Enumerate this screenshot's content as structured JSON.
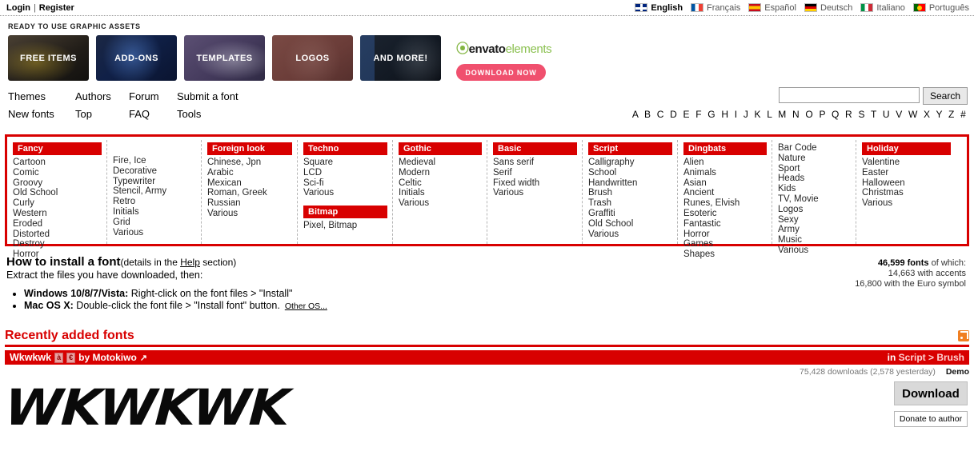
{
  "topbar": {
    "login": "Login",
    "separator": "|",
    "register": "Register",
    "languages": [
      {
        "name": "English",
        "flag": "uk",
        "active": true
      },
      {
        "name": "Français",
        "flag": "fr",
        "active": false
      },
      {
        "name": "Español",
        "flag": "es",
        "active": false
      },
      {
        "name": "Deutsch",
        "flag": "de",
        "active": false
      },
      {
        "name": "Italiano",
        "flag": "it",
        "active": false
      },
      {
        "name": "Português",
        "flag": "pt",
        "active": false
      }
    ]
  },
  "ad": {
    "title": "READY TO USE GRAPHIC ASSETS",
    "tiles": [
      {
        "label": "FREE ITEMS"
      },
      {
        "label": "ADD-ONS"
      },
      {
        "label": "TEMPLATES"
      },
      {
        "label": "LOGOS"
      },
      {
        "label": "AND MORE!"
      }
    ],
    "brand_leaf": "envato",
    "brand_rest": "elements",
    "cta": "DOWNLOAD NOW",
    "cta_color": "#f0506e"
  },
  "nav": {
    "items": [
      "Themes",
      "Authors",
      "Forum",
      "Submit a font",
      "New fonts",
      "Top",
      "FAQ",
      "Tools"
    ]
  },
  "search": {
    "value": "",
    "placeholder": "",
    "button": "Search",
    "alphabet": "A B C D E F G H I J K L M N O P Q R S T U V W X Y Z #"
  },
  "categories": [
    {
      "header": "Fancy",
      "items": [
        "Cartoon",
        "Comic",
        "Groovy",
        "Old School",
        "Curly",
        "Western",
        "Eroded",
        "Distorted",
        "Destroy",
        "Horror"
      ]
    },
    {
      "header": null,
      "items": [
        "Fire, Ice",
        "Decorative",
        "Typewriter",
        "Stencil, Army",
        "Retro",
        "Initials",
        "Grid",
        "Various"
      ]
    },
    {
      "header": "Foreign look",
      "items": [
        "Chinese, Jpn",
        "Arabic",
        "Mexican",
        "Roman, Greek",
        "Russian",
        "Various"
      ]
    },
    {
      "header": "Techno",
      "items": [
        "Square",
        "LCD",
        "Sci-fi",
        "Various"
      ],
      "header2": "Bitmap",
      "items2": [
        "Pixel, Bitmap"
      ]
    },
    {
      "header": "Gothic",
      "items": [
        "Medieval",
        "Modern",
        "Celtic",
        "Initials",
        "Various"
      ]
    },
    {
      "header": "Basic",
      "items": [
        "Sans serif",
        "Serif",
        "Fixed width",
        "Various"
      ]
    },
    {
      "header": "Script",
      "items": [
        "Calligraphy",
        "School",
        "Handwritten",
        "Brush",
        "Trash",
        "Graffiti",
        "Old School",
        "Various"
      ]
    },
    {
      "header": "Dingbats",
      "items": [
        "Alien",
        "Animals",
        "Asian",
        "Ancient",
        "Runes, Elvish",
        "Esoteric",
        "Fantastic",
        "Horror",
        "Games",
        "Shapes"
      ]
    },
    {
      "header": null,
      "items": [
        "Bar Code",
        "Nature",
        "Sport",
        "Heads",
        "Kids",
        "TV, Movie",
        "Logos",
        "Sexy",
        "Army",
        "Music",
        "Various"
      ]
    },
    {
      "header": "Holiday",
      "items": [
        "Valentine",
        "Easter",
        "Halloween",
        "Christmas",
        "Various"
      ]
    }
  ],
  "install": {
    "heading": "How to install a font",
    "heading_sub_pre": "(details in the ",
    "heading_sub_link": "Help",
    "heading_sub_post": " section)",
    "intro": "Extract the files you have downloaded, then:",
    "bullets": [
      {
        "os": "Windows 10/8/7/Vista:",
        "text": " Right-click on the font files > \"Install\"",
        "extra": ""
      },
      {
        "os": "Mac OS X:",
        "text": " Double-click the font file > \"Install font\" button.",
        "extra": "Other OS..."
      }
    ]
  },
  "counts": {
    "total": "46,599 fonts",
    "total_suffix": " of which:",
    "accents": "14,663 with accents",
    "euro": "16,800 with the Euro symbol"
  },
  "recent": {
    "heading": "Recently added fonts",
    "rss_icon": "rss-icon",
    "font": {
      "name": "Wkwkwk",
      "badge_accent": "à",
      "badge_euro": "€",
      "by": "by Motokiwo",
      "external_icon": "external-link-icon",
      "category_prefix": "in ",
      "category": "Script > Brush",
      "downloads": "75,428 downloads (2,578 yesterday)",
      "demo": "Demo",
      "preview_text": "WKWKWK",
      "download_button": "Download",
      "donate_button": "Donate to author"
    }
  },
  "colors": {
    "brand_red": "#d80000",
    "rss_orange": "#f07f22",
    "envato_green": "#8cc152"
  }
}
